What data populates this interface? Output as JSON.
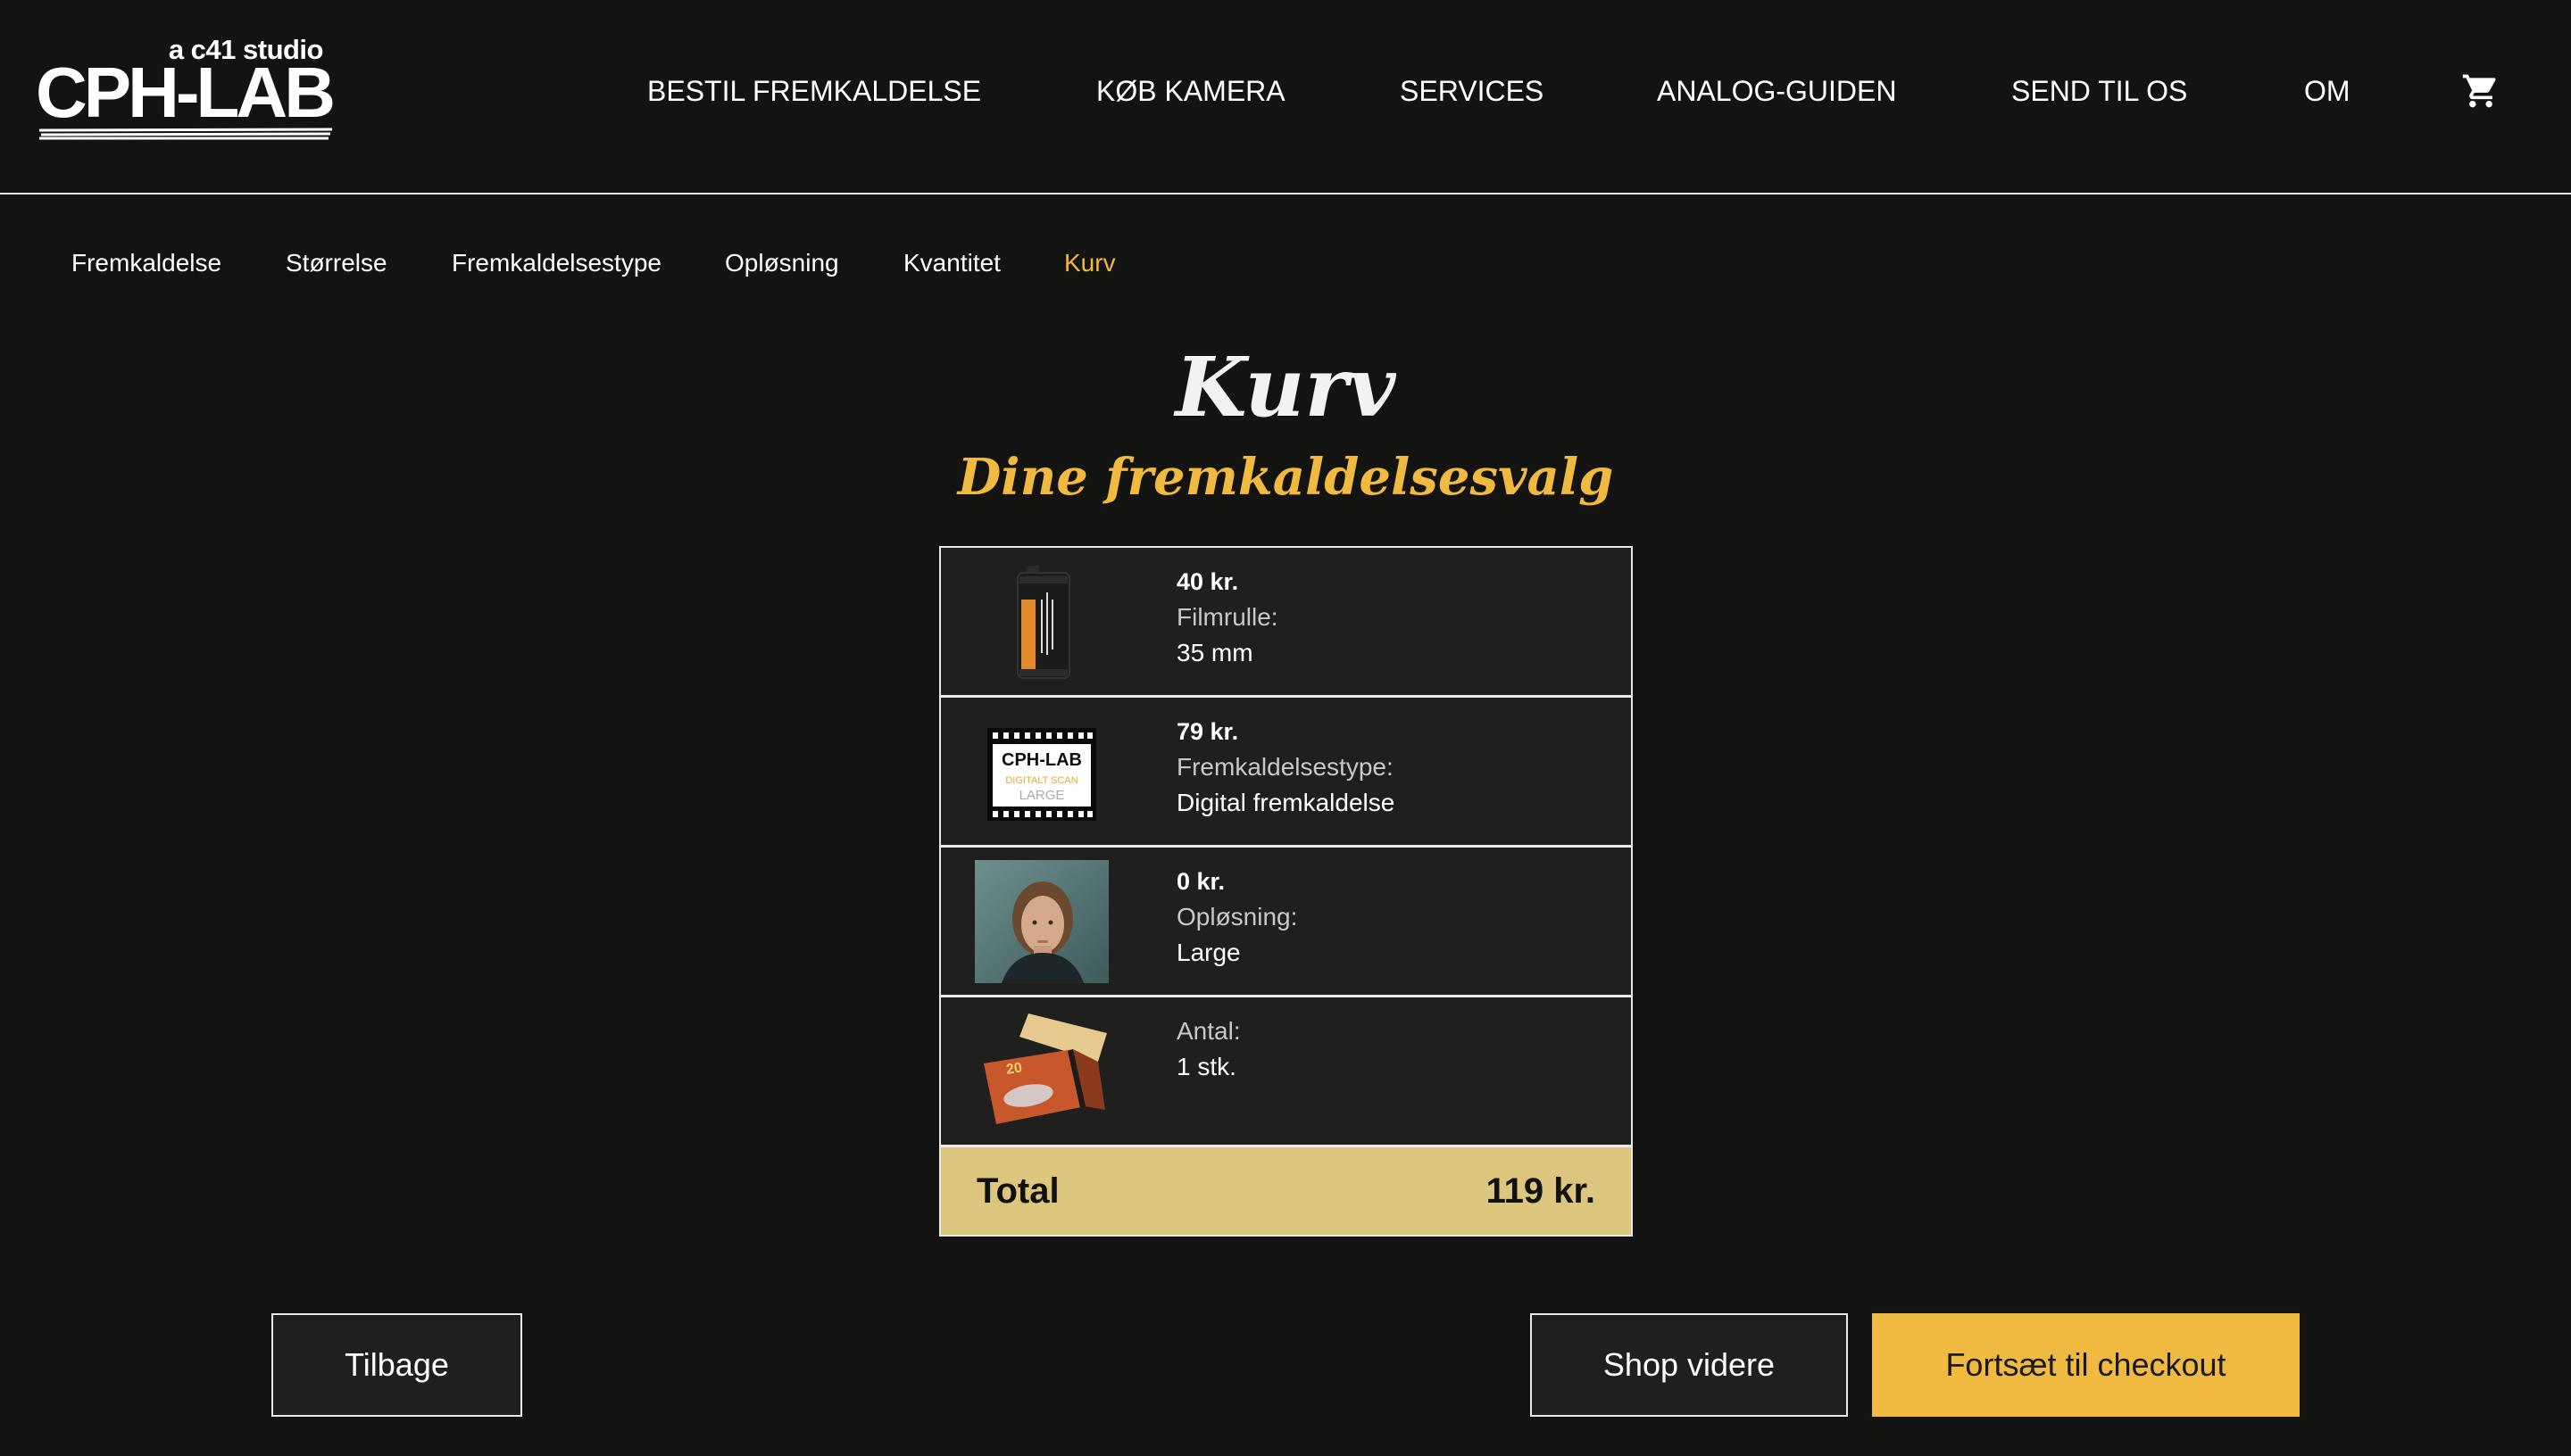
{
  "logo": {
    "tagline": "a c41 studio",
    "name": "CPH-LAB"
  },
  "nav": [
    {
      "label": "BESTIL FREMKALDELSE"
    },
    {
      "label": "KØB KAMERA"
    },
    {
      "label": "SERVICES"
    },
    {
      "label": "ANALOG-GUIDEN"
    },
    {
      "label": "SEND TIL OS"
    },
    {
      "label": "OM"
    }
  ],
  "cart_icon": "shopping-cart-icon",
  "steps": [
    {
      "label": "Fremkaldelse"
    },
    {
      "label": "Størrelse"
    },
    {
      "label": "Fremkaldelsestype"
    },
    {
      "label": "Opløsning"
    },
    {
      "label": "Kvantitet"
    },
    {
      "label": "Kurv",
      "active": true
    }
  ],
  "page": {
    "title": "Kurv",
    "subtitle": "Dine fremkaldelsesvalg"
  },
  "items": [
    {
      "price": "40 kr.",
      "label": "Filmrulle:",
      "value": "35 mm",
      "image": "film-canister-image"
    },
    {
      "price": "79 kr.",
      "label": "Fremkaldelsestype:",
      "value": "Digital fremkaldelse",
      "image": "digital-scan-image",
      "image_text": {
        "brand": "CPH-LAB",
        "line1": "DIGITALT SCAN",
        "line2": "LARGE"
      }
    },
    {
      "price": "0 kr.",
      "label": "Opløsning:",
      "value": "Large",
      "image": "portrait-photo-image"
    },
    {
      "price": "",
      "label": "Antal:",
      "value": "1 stk.",
      "image": "film-box-image"
    }
  ],
  "total": {
    "label": "Total",
    "value": "119 kr."
  },
  "buttons": {
    "back": "Tilbage",
    "shop": "Shop videre",
    "checkout": "Fortsæt til checkout"
  },
  "colors": {
    "background": "#131412",
    "accent": "#f0b93f",
    "total_bg": "#dcc57d",
    "row_bg": "#1f201e"
  }
}
